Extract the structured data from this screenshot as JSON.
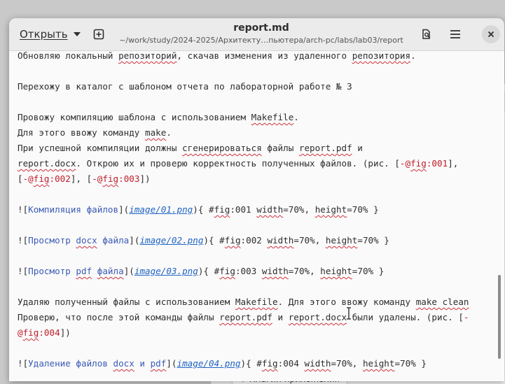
{
  "header": {
    "open_label": "Открыть",
    "title": "report.md",
    "path": "~/work/study/2024-2025/Архитекту…пьютера/arch-pc/labs/lab03/report"
  },
  "icons": {
    "open_caret": "chevron-down-icon",
    "new_tab": "new-tab-icon",
    "search": "search-document-icon",
    "menu": "hamburger-menu-icon",
    "close": "close-icon"
  },
  "background": {
    "fragment": "+ Плагин приложения"
  },
  "editor": {
    "lines": [
      [
        {
          "t": "Обновляю локальный "
        },
        {
          "t": "репозиторий",
          "c": "sp"
        },
        {
          "t": ", скачав изменения из удаленного "
        },
        {
          "t": "репозитория",
          "c": "sp"
        },
        {
          "t": "."
        }
      ],
      [],
      [
        {
          "t": "Перехожу в каталог с шаблоном отчета по лабораторной работе № 3"
        }
      ],
      [],
      [
        {
          "t": "Провожу компиляцию шаблона с использованием "
        },
        {
          "t": "Makefile",
          "c": "sp"
        },
        {
          "t": "."
        }
      ],
      [
        {
          "t": "Для этого ввожу команду "
        },
        {
          "t": "make",
          "c": "sp"
        },
        {
          "t": "."
        }
      ],
      [
        {
          "t": "При успешной компиляции должны "
        },
        {
          "t": "сгенерироваться",
          "c": "sp"
        },
        {
          "t": " файлы "
        },
        {
          "t": "report.pdf",
          "c": "sp"
        },
        {
          "t": " и"
        }
      ],
      [
        {
          "t": "report.docx",
          "c": "sp"
        },
        {
          "t": ". Открою их и проверю корректность полученных файлов. (рис. ["
        },
        {
          "t": "-@",
          "c": "red"
        },
        {
          "t": "fig",
          "c": "red sp"
        },
        {
          "t": ":001",
          "c": "red"
        },
        {
          "t": "],"
        }
      ],
      [
        {
          "t": "["
        },
        {
          "t": "-@",
          "c": "red"
        },
        {
          "t": "fig",
          "c": "red sp"
        },
        {
          "t": ":002",
          "c": "red"
        },
        {
          "t": "], ["
        },
        {
          "t": "-@",
          "c": "red"
        },
        {
          "t": "fig",
          "c": "red sp"
        },
        {
          "t": ":003",
          "c": "red"
        },
        {
          "t": "])"
        }
      ],
      [],
      [
        {
          "t": "!["
        },
        {
          "t": "Компиляция файлов",
          "c": "lnk"
        },
        {
          "t": "]("
        },
        {
          "t": "image/01.png",
          "c": "url"
        },
        {
          "t": "){ #"
        },
        {
          "t": "fig",
          "c": "sp"
        },
        {
          "t": ":001 "
        },
        {
          "t": "width",
          "c": "sp"
        },
        {
          "t": "=70%, "
        },
        {
          "t": "height",
          "c": "sp"
        },
        {
          "t": "=70% }"
        }
      ],
      [],
      [
        {
          "t": "!["
        },
        {
          "t": "Просмотр ",
          "c": "lnk"
        },
        {
          "t": "docx",
          "c": "lnk sp"
        },
        {
          "t": " файла",
          "c": "lnk"
        },
        {
          "t": "]("
        },
        {
          "t": "image/02.png",
          "c": "url"
        },
        {
          "t": "){ #"
        },
        {
          "t": "fig",
          "c": "sp"
        },
        {
          "t": ":002 "
        },
        {
          "t": "width",
          "c": "sp"
        },
        {
          "t": "=70%, "
        },
        {
          "t": "height",
          "c": "sp"
        },
        {
          "t": "=70% }"
        }
      ],
      [],
      [
        {
          "t": "!["
        },
        {
          "t": "Просмотр ",
          "c": "lnk"
        },
        {
          "t": "pdf",
          "c": "lnk sp"
        },
        {
          "t": " ",
          "c": "lnk"
        },
        {
          "t": "файла",
          "c": "lnk sp"
        },
        {
          "t": "]("
        },
        {
          "t": "image/03.png",
          "c": "url"
        },
        {
          "t": "){ #"
        },
        {
          "t": "fig",
          "c": "sp"
        },
        {
          "t": ":003 "
        },
        {
          "t": "width",
          "c": "sp"
        },
        {
          "t": "=70%, "
        },
        {
          "t": "height",
          "c": "sp"
        },
        {
          "t": "=70% }"
        }
      ],
      [],
      [
        {
          "t": "Удаляю полученный файлы с использованием "
        },
        {
          "t": "Makefile",
          "c": "sp"
        },
        {
          "t": ". Для этого ввожу команду "
        },
        {
          "t": "make clean",
          "c": "sp"
        }
      ],
      [
        {
          "t": "Проверю, что после этой команды файлы "
        },
        {
          "t": "report.pdf",
          "c": "sp"
        },
        {
          "t": " и "
        },
        {
          "t": "report.docx",
          "c": "sp"
        },
        {
          "t": " были удалены. (рис. ["
        },
        {
          "t": "-",
          "c": "red"
        }
      ],
      [
        {
          "t": "@",
          "c": "red"
        },
        {
          "t": "fig",
          "c": "red sp"
        },
        {
          "t": ":004",
          "c": "red"
        },
        {
          "t": "])"
        }
      ],
      [],
      [
        {
          "t": "!["
        },
        {
          "t": "Удаление файлов ",
          "c": "lnk"
        },
        {
          "t": "docx",
          "c": "lnk sp"
        },
        {
          "t": " и ",
          "c": "lnk"
        },
        {
          "t": "pdf",
          "c": "lnk sp"
        },
        {
          "t": "]("
        },
        {
          "t": "image/04.png",
          "c": "url"
        },
        {
          "t": "){ #"
        },
        {
          "t": "fig",
          "c": "sp"
        },
        {
          "t": ":004 "
        },
        {
          "t": "width",
          "c": "sp"
        },
        {
          "t": "=70%, "
        },
        {
          "t": "height",
          "c": "sp"
        },
        {
          "t": "=70% }"
        }
      ]
    ]
  }
}
